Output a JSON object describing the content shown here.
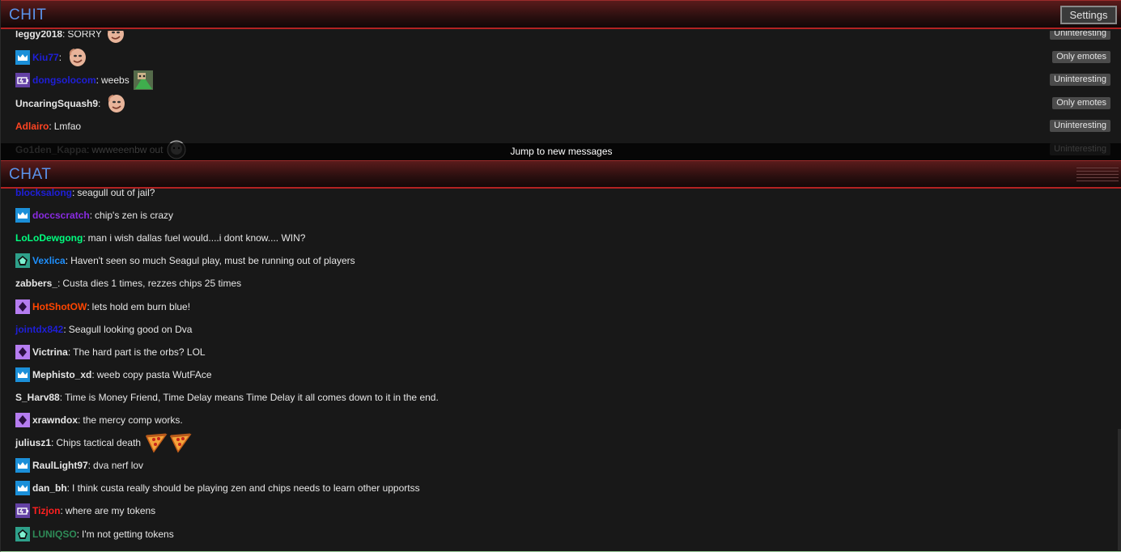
{
  "top_panel": {
    "title": "CHIT",
    "settings_label": "Settings",
    "jump_label": "Jump to new messages",
    "messages": [
      {
        "user": "leggy2018",
        "user_color": "#e6e6e6",
        "badge": "",
        "text": "SORRY",
        "emotes": [
          "face-emote"
        ],
        "tag": "Uninteresting"
      },
      {
        "user": "Kiu77",
        "user_color": "#1f1fd8",
        "badge": "crown",
        "text": "",
        "emotes": [
          "face-emote"
        ],
        "tag": "Only emotes"
      },
      {
        "user": "dongsolocom",
        "user_color": "#1f1fd8",
        "badge": "battery",
        "text": "weebs",
        "emotes": [
          "weeb-emote"
        ],
        "tag": "Uninteresting"
      },
      {
        "user": "UncaringSquash9",
        "user_color": "#e6e6e6",
        "badge": "",
        "text": "",
        "emotes": [
          "face-emote"
        ],
        "tag": "Only emotes"
      },
      {
        "user": "Adlairo",
        "user_color": "#ff4422",
        "badge": "",
        "text": "Lmfao",
        "emotes": [],
        "tag": "Uninteresting"
      },
      {
        "user": "Go1den_Kappa",
        "user_color": "#9a9a9a",
        "badge": "",
        "text": "wwweeenbw out",
        "emotes": [
          "dark-face-emote"
        ],
        "tag": "Uninteresting"
      }
    ]
  },
  "bottom_panel": {
    "title": "CHAT",
    "messages": [
      {
        "user": "blocksalong",
        "user_color": "#1f1fd8",
        "badge": "",
        "text": "seagull out of jail?",
        "emotes": []
      },
      {
        "user": "doccscratch",
        "user_color": "#8a2be2",
        "badge": "crown",
        "text": "chip's zen is crazy",
        "emotes": []
      },
      {
        "user": "LoLoDewgong",
        "user_color": "#00ff7f",
        "badge": "",
        "text": "man i wish dallas fuel would....i dont know.... WIN?",
        "emotes": []
      },
      {
        "user": "Vexlica",
        "user_color": "#1e90ff",
        "badge": "pentagon",
        "text": "Haven't seen so much Seagul play, must be running out of players",
        "emotes": []
      },
      {
        "user": "zabbers_",
        "user_color": "#e6e6e6",
        "badge": "",
        "text": "Custa dies 1 times, rezzes chips 25 times",
        "emotes": []
      },
      {
        "user": "HotShotOW",
        "user_color": "#ff4500",
        "badge": "diamond",
        "text": "lets hold em burn blue!",
        "emotes": []
      },
      {
        "user": "jointdx842",
        "user_color": "#1f1fd8",
        "badge": "",
        "text": "Seagull looking good on Dva",
        "emotes": []
      },
      {
        "user": "Victrina",
        "user_color": "#e6e6e6",
        "badge": "diamond",
        "text": "The hard part is the orbs? LOL",
        "emotes": []
      },
      {
        "user": "Mephisto_xd",
        "user_color": "#e6e6e6",
        "badge": "crown",
        "text": "weeb copy pasta WutFAce",
        "emotes": []
      },
      {
        "user": "S_Harv88",
        "user_color": "#e6e6e6",
        "badge": "",
        "text": "Time is Money Friend, Time Delay means Time Delay it all comes down to it in the end.",
        "emotes": []
      },
      {
        "user": "xrawndox",
        "user_color": "#e6e6e6",
        "badge": "diamond",
        "text": "the mercy comp works.",
        "emotes": []
      },
      {
        "user": "juliusz1",
        "user_color": "#e6e6e6",
        "badge": "",
        "text": "Chips tactical death",
        "emotes": [
          "pizza-emote",
          "pizza-emote"
        ]
      },
      {
        "user": "RaulLight97",
        "user_color": "#e6e6e6",
        "badge": "crown",
        "text": "dva nerf lov",
        "emotes": []
      },
      {
        "user": "dan_bh",
        "user_color": "#e6e6e6",
        "badge": "crown",
        "text": "I think custa really should be playing zen and chips needs to learn other upportss",
        "emotes": []
      },
      {
        "user": "Tizjon",
        "user_color": "#ff2020",
        "badge": "battery",
        "text": "where are my tokens",
        "emotes": []
      },
      {
        "user": "LUNIQSO",
        "user_color": "#2e8b57",
        "badge": "pentagon",
        "text": "I'm not getting tokens",
        "emotes": []
      }
    ]
  }
}
